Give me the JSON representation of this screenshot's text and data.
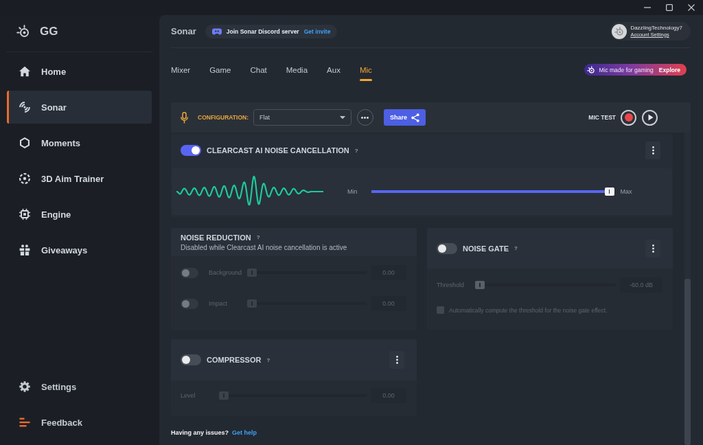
{
  "sidebar": {
    "logo": "GG",
    "items": [
      {
        "label": "Home",
        "selected": false
      },
      {
        "label": "Sonar",
        "selected": true
      },
      {
        "label": "Moments",
        "selected": false
      },
      {
        "label": "3D Aim Trainer",
        "selected": false
      },
      {
        "label": "Engine",
        "selected": false
      },
      {
        "label": "Giveaways",
        "selected": false
      }
    ],
    "footer_items": [
      {
        "label": "Settings"
      },
      {
        "label": "Feedback"
      }
    ]
  },
  "header": {
    "title": "Sonar",
    "discord": {
      "text": "Join Sonar Discord server",
      "link": "Get invite"
    },
    "account": {
      "name": "DazzlingTechnology7",
      "link": "Account Settings"
    }
  },
  "tabs": [
    {
      "label": "Mixer",
      "selected": false
    },
    {
      "label": "Game",
      "selected": false
    },
    {
      "label": "Chat",
      "selected": false
    },
    {
      "label": "Media",
      "selected": false
    },
    {
      "label": "Aux",
      "selected": false
    },
    {
      "label": "Mic",
      "selected": true
    }
  ],
  "promo": {
    "text": "Mic made for gaming",
    "link": "Explore"
  },
  "config_bar": {
    "label": "CONFIGURATION:",
    "preset": "Flat",
    "share": "Share",
    "mic_test": "MIC TEST"
  },
  "clearcast": {
    "title": "CLEARCAST AI NOISE CANCELLATION",
    "help": "?",
    "on": true,
    "min_label": "Min",
    "max_label": "Max",
    "level": 1
  },
  "noise_reduction": {
    "title": "NOISE REDUCTION",
    "help": "?",
    "note": "Disabled while Clearcast AI noise cancellation is active",
    "disabled": true,
    "rows": [
      {
        "label": "Background",
        "on": false,
        "level": 0,
        "value": "0.00"
      },
      {
        "label": "Impact",
        "on": false,
        "level": 0,
        "value": "0.00"
      }
    ]
  },
  "noise_gate": {
    "title": "NOISE GATE",
    "help": "?",
    "on": false,
    "threshold": {
      "label": "Threshold",
      "level": 0,
      "value": "-60.0 dB"
    },
    "auto_threshold": {
      "label": "Automatically compute the threshold for the noise gate effect.",
      "checked": false
    }
  },
  "compressor": {
    "title": "COMPRESSOR",
    "help": "?",
    "on": false,
    "row": {
      "label": "Level",
      "level": 0,
      "value": "0.00"
    }
  },
  "footer": {
    "text": "Having any issues?",
    "link": "Get help"
  }
}
